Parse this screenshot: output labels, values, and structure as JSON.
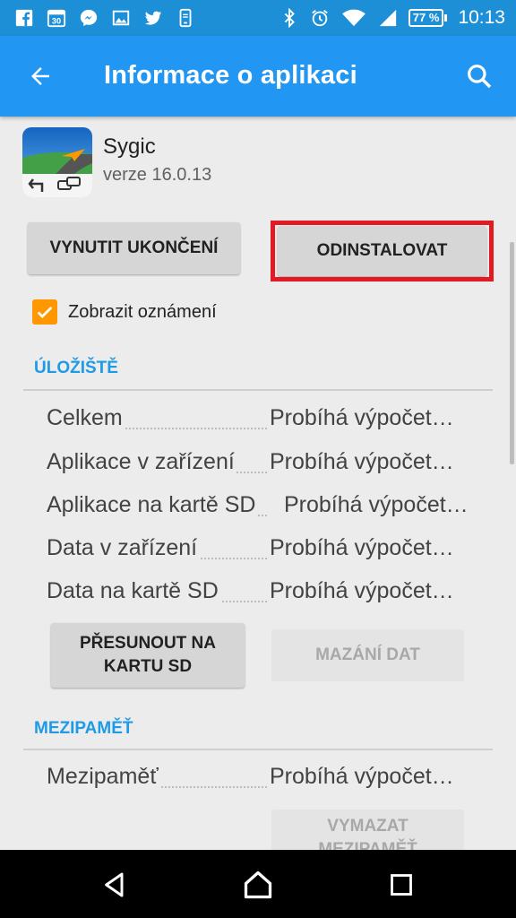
{
  "status_bar": {
    "time": "10:13",
    "battery": "77 %",
    "left_icons": [
      "facebook-icon",
      "calendar-icon",
      "messenger-icon",
      "gallery-icon",
      "twitter-icon",
      "phone-icon"
    ],
    "right_icons": [
      "bluetooth-icon",
      "alarm-icon",
      "wifi-icon",
      "signal-icon",
      "battery-icon"
    ]
  },
  "app_bar": {
    "title": "Informace o aplikaci"
  },
  "app": {
    "name": "Sygic",
    "version": "verze 16.0.13"
  },
  "buttons": {
    "force_stop": "VYNUTIT UKONČENÍ",
    "uninstall": "ODINSTALOVAT",
    "move_to_sd_line1": "PŘESUNOUT NA",
    "move_to_sd_line2": "KARTU SD",
    "clear_data": "MAZÁNÍ DAT",
    "clear_cache_line1": "VYMAZAT",
    "clear_cache_line2": "MEZIPAMĚŤ"
  },
  "notifications": {
    "label": "Zobrazit oznámení",
    "checked": true
  },
  "storage": {
    "title": "ÚLOŽIŠTĚ",
    "rows": [
      {
        "label": "Celkem",
        "value": "Probíhá výpočet…"
      },
      {
        "label": "Aplikace v zařízení",
        "value": "Probíhá výpočet…"
      },
      {
        "label": "Aplikace na kartě SD",
        "value": "Probíhá výpočet…"
      },
      {
        "label": "Data v zařízení",
        "value": "Probíhá výpočet…"
      },
      {
        "label": "Data na kartě SD",
        "value": "Probíhá výpočet…"
      }
    ]
  },
  "cache": {
    "title": "MEZIPAMĚŤ",
    "rows": [
      {
        "label": "Mezipaměť",
        "value": "Probíhá výpočet…"
      }
    ]
  },
  "colors": {
    "status_bar": "#1c8fd6",
    "app_bar": "#2196f3",
    "section_title": "#1e9ae6",
    "checkbox": "#ff9800",
    "highlight": "#e21a22"
  }
}
